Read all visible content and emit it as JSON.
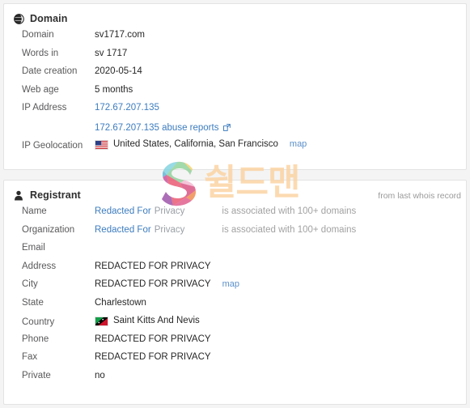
{
  "domain_card": {
    "icon": "globe-icon",
    "title": "Domain",
    "rows": [
      {
        "label": "Domain",
        "value": "sv1717.com",
        "type": "text"
      },
      {
        "label": "Words in",
        "value": "sv 1717",
        "type": "text"
      },
      {
        "label": "Date creation",
        "value": "2020-05-14",
        "type": "text"
      },
      {
        "label": "Web age",
        "value": "5 months",
        "type": "text"
      },
      {
        "label": "IP Address",
        "value": "172.67.207.135",
        "type": "link"
      }
    ],
    "ip_abuse_link": "172.67.207.135 abuse reports",
    "ip_abuse_icon": "external-link-icon",
    "geolocation": {
      "label": "IP Geolocation",
      "flag": "us-flag-icon",
      "value": "United States, California, San Francisco",
      "map_label": "map"
    }
  },
  "registrant_card": {
    "icon": "user-icon",
    "title": "Registrant",
    "note": "from last whois record",
    "rows": [
      {
        "label": "Name",
        "link_text": "Redacted For",
        "muted_text": "Privacy",
        "note": "is associated with 100+ domains",
        "type": "redacted-link"
      },
      {
        "label": "Organization",
        "link_text": "Redacted For",
        "muted_text": "Privacy",
        "note": "is associated with 100+ domains",
        "type": "redacted-link"
      },
      {
        "label": "Email",
        "value": "",
        "type": "text"
      },
      {
        "label": "Address",
        "value": "REDACTED FOR PRIVACY",
        "type": "text"
      },
      {
        "label": "City",
        "value": "REDACTED FOR PRIVACY",
        "map_label": "map",
        "type": "text-map"
      },
      {
        "label": "State",
        "value": "Charlestown",
        "type": "text"
      },
      {
        "label": "Country",
        "value": "Saint Kitts And Nevis",
        "flag": "saint-kitts-nevis-flag-icon",
        "type": "flag-text"
      },
      {
        "label": "Phone",
        "value": "REDACTED FOR PRIVACY",
        "type": "text"
      },
      {
        "label": "Fax",
        "value": "REDACTED FOR PRIVACY",
        "type": "text"
      },
      {
        "label": "Private",
        "value": "no",
        "type": "text"
      }
    ]
  },
  "watermark": {
    "logo": "shieldman-s-logo",
    "text": "쉴드맨"
  },
  "colors": {
    "link": "#3c7cbf",
    "muted": "#9aa0a6",
    "label": "#59595b",
    "value": "#262626",
    "card_border": "#e3e3e3",
    "watermark_text": "#fcd2a0"
  }
}
